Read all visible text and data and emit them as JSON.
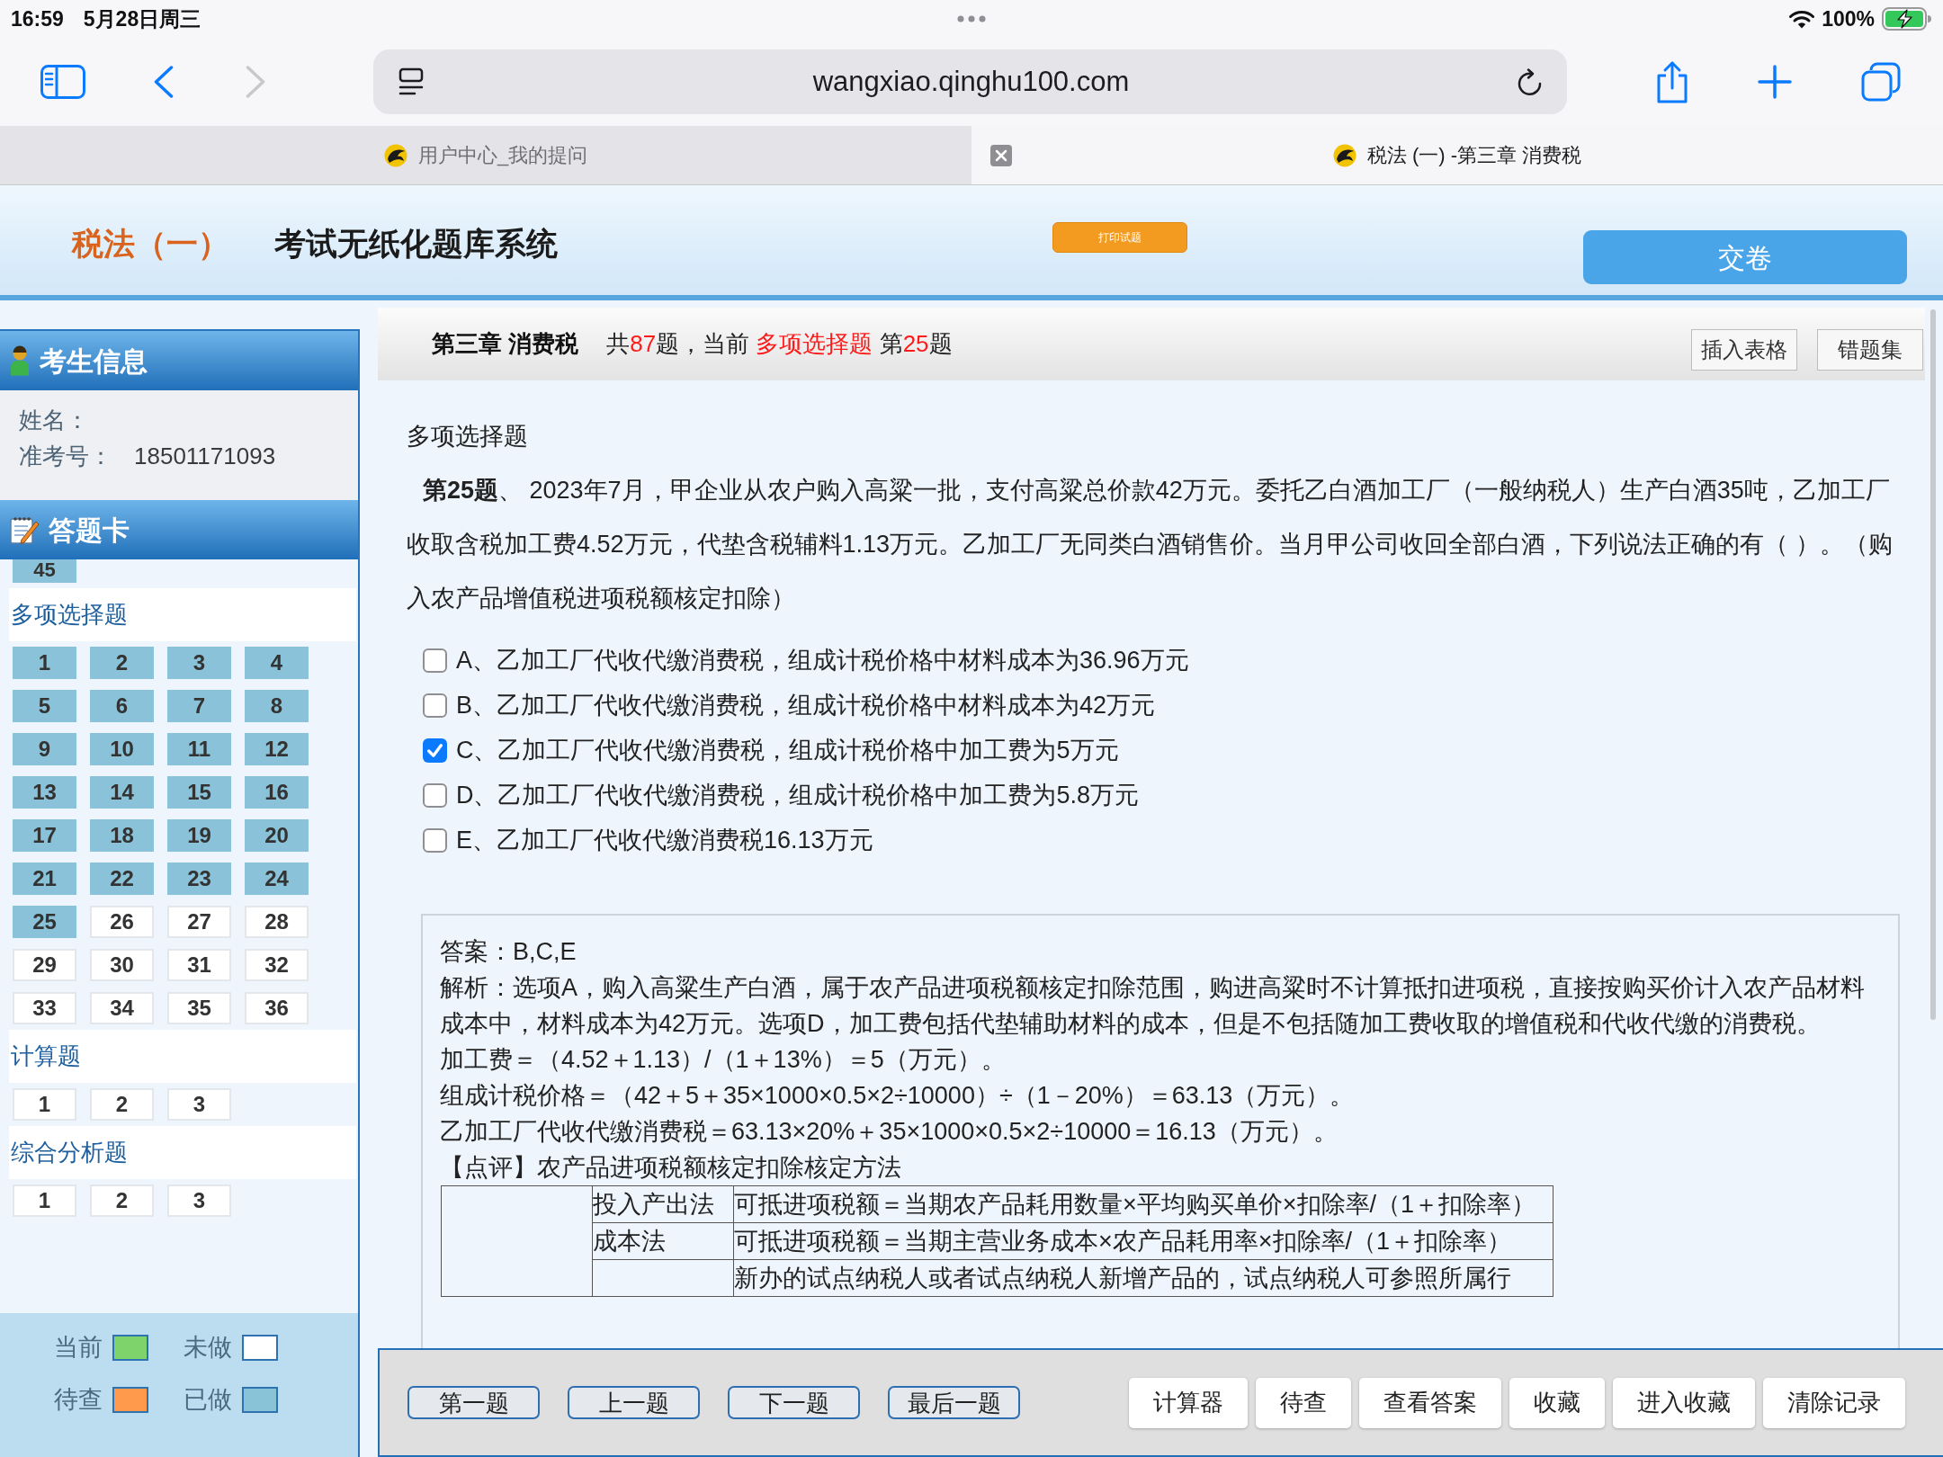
{
  "status_bar": {
    "time": "16:59",
    "date": "5月28日周三",
    "battery": "100%"
  },
  "browser": {
    "back": {
      "disabled": false
    },
    "forward": {
      "disabled": true
    },
    "url": "wangxiao.qinghu100.com",
    "tabs": [
      {
        "title": "用户中心_我的提问",
        "selected": false
      },
      {
        "title": "税法 (一) -第三章 消费税",
        "selected": true
      }
    ]
  },
  "header": {
    "subject": "税法（一）",
    "title": "考试无纸化题库系统",
    "print_button": "打印试题",
    "submit_button": "交卷"
  },
  "sidebar": {
    "candidate": {
      "title": "考生信息",
      "fields": [
        {
          "label": "姓名："
        },
        {
          "label": "准考号：",
          "value": "18501171093"
        }
      ]
    },
    "answer_card": {
      "title": "答题卡",
      "sections": [
        {
          "items": [
            {
              "number": "45",
              "done": true
            }
          ]
        },
        {
          "title": "多项选择题",
          "items": [
            {
              "number": "1",
              "done": true
            },
            {
              "number": "2",
              "done": true
            },
            {
              "number": "3",
              "done": true
            },
            {
              "number": "4",
              "done": true
            },
            {
              "number": "5",
              "done": true
            },
            {
              "number": "6",
              "done": true
            },
            {
              "number": "7",
              "done": true
            },
            {
              "number": "8",
              "done": true
            },
            {
              "number": "9",
              "done": true
            },
            {
              "number": "10",
              "done": true
            },
            {
              "number": "11",
              "done": true
            },
            {
              "number": "12",
              "done": true
            },
            {
              "number": "13",
              "done": true
            },
            {
              "number": "14",
              "done": true
            },
            {
              "number": "15",
              "done": true
            },
            {
              "number": "16",
              "done": true
            },
            {
              "number": "17",
              "done": true
            },
            {
              "number": "18",
              "done": true
            },
            {
              "number": "19",
              "done": true
            },
            {
              "number": "20",
              "done": true
            },
            {
              "number": "21",
              "done": true
            },
            {
              "number": "22",
              "done": true
            },
            {
              "number": "23",
              "done": true
            },
            {
              "number": "24",
              "done": true
            },
            {
              "number": "25",
              "done": true
            },
            {
              "number": "26",
              "done": false
            },
            {
              "number": "27",
              "done": false
            },
            {
              "number": "28",
              "done": false
            },
            {
              "number": "29",
              "done": false
            },
            {
              "number": "30",
              "done": false
            },
            {
              "number": "31",
              "done": false
            },
            {
              "number": "32",
              "done": false
            },
            {
              "number": "33",
              "done": false
            },
            {
              "number": "34",
              "done": false
            },
            {
              "number": "35",
              "done": false
            },
            {
              "number": "36",
              "done": false
            }
          ]
        },
        {
          "title": "计算题",
          "items": [
            {
              "number": "1",
              "done": false
            },
            {
              "number": "2",
              "done": false
            },
            {
              "number": "3",
              "done": false
            }
          ]
        },
        {
          "title": "综合分析题",
          "items": [
            {
              "number": "1",
              "done": false
            },
            {
              "number": "2",
              "done": false
            },
            {
              "number": "3",
              "done": false
            }
          ]
        }
      ]
    },
    "legend": [
      {
        "label": "当前",
        "color": "#7ed36b"
      },
      {
        "label": "未做",
        "color": "#ffffff"
      },
      {
        "label": "待查",
        "color": "#ff9a4c"
      },
      {
        "label": "已做",
        "color": "#89c3d8"
      }
    ]
  },
  "question_header": {
    "chapter": "第三章 消费税",
    "progress": [
      {
        "text": "共",
        "highlight": false
      },
      {
        "text": "87",
        "highlight": true
      },
      {
        "text": "题，当前 ",
        "highlight": false
      },
      {
        "text": "多项选择题",
        "highlight": true
      },
      {
        "text": " 第",
        "highlight": false
      },
      {
        "text": "25",
        "highlight": true
      },
      {
        "text": "题",
        "highlight": false
      }
    ],
    "buttons": [
      "插入表格",
      "错题集"
    ]
  },
  "question": {
    "type": "多项选择题",
    "text": "**第25题**、 2023年7月，甲企业从农户购入高粱一批，支付高粱总价款42万元。委托乙白酒加工厂（一般纳税人）生产白酒35吨，乙加工厂收取含税加工费4.52万元，代垫含税辅料1.13万元。乙加工厂无同类白酒销售价。当月甲公司收回全部白酒，下列说法正确的有（  ）。（购入农产品增值税进项税额核定扣除）",
    "options": [
      {
        "text": "A、乙加工厂代收代缴消费税，组成计税价格中材料成本为36.96万元",
        "checked": false
      },
      {
        "text": "B、乙加工厂代收代缴消费税，组成计税价格中材料成本为42万元",
        "checked": false
      },
      {
        "text": "C、乙加工厂代收代缴消费税，组成计税价格中加工费为5万元",
        "checked": true
      },
      {
        "text": "D、乙加工厂代收代缴消费税，组成计税价格中加工费为5.8万元",
        "checked": false
      },
      {
        "text": "E、乙加工厂代收代缴消费税16.13万元",
        "checked": false
      }
    ]
  },
  "answer_panel": {
    "answer": "答案：B,C,E",
    "analysis": "解析：选项A，购入高粱生产白酒，属于农产品进项税额核定扣除范围，购进高粱时不计算抵扣进项税，直接按购买价计入农产品材料成本中，材料成本为42万元。选项D，加工费包括代垫辅助材料的成本，但是不包括随加工费收取的增值税和代收代缴的消费税。",
    "formulas": [
      "加工费＝（4.52＋1.13）/（1＋13%）＝5（万元）。",
      "组成计税价格＝（42＋5＋35×1000×0.5×2÷10000）÷（1－20%）＝63.13（万元）。",
      "乙加工厂代收代缴消费税＝63.13×20%＋35×1000×0.5×2÷10000＝16.13（万元）。"
    ],
    "review": "【点评】农产品进项税额核定扣除核定方法",
    "table": {
      "rows": [
        {
          "method": "投入产出法",
          "formula": "可抵进项税额＝当期农产品耗用数量×平均购买单价×扣除率/（1＋扣除率）"
        },
        {
          "method": "成本法",
          "formula": "可抵进项税额＝当期主营业务成本×农产品耗用率×扣除率/（1＋扣除率）"
        },
        {
          "formula": "新办的试点纳税人或者试点纳税人新增产品的，试点纳税人可参照所属行"
        }
      ]
    }
  },
  "nav_buttons": [
    "第一题",
    "上一题",
    "下一题",
    "最后一题"
  ],
  "tool_buttons": [
    "计算器",
    "待查",
    "查看答案",
    "收藏",
    "进入收藏",
    "清除记录"
  ]
}
